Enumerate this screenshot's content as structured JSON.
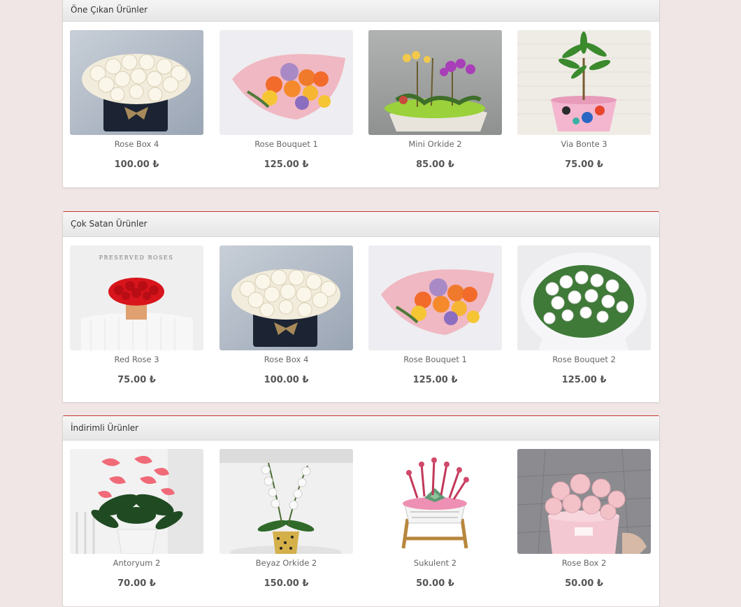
{
  "sections": [
    {
      "title": "Öne Çıkan Ürünler",
      "products": [
        {
          "name": "Rose Box 4",
          "price": "100.00 ₺",
          "image": "white-roses-box"
        },
        {
          "name": "Rose Bouquet 1",
          "price": "125.00 ₺",
          "image": "mixed-rose-bouquet"
        },
        {
          "name": "Mini Orkide 2",
          "price": "85.00 ₺",
          "image": "mini-orchid-arrangement"
        },
        {
          "name": "Via Bonte 3",
          "price": "75.00 ₺",
          "image": "plant-painted-pot"
        }
      ]
    },
    {
      "title": "Çok Satan Ürünler",
      "products": [
        {
          "name": "Red Rose 3",
          "price": "75.00 ₺",
          "image": "red-roses-preserved",
          "image_text": "PRESERVED ROSES"
        },
        {
          "name": "Rose Box 4",
          "price": "100.00 ₺",
          "image": "white-roses-box"
        },
        {
          "name": "Rose Bouquet 1",
          "price": "125.00 ₺",
          "image": "mixed-rose-bouquet"
        },
        {
          "name": "Rose Bouquet 2",
          "price": "125.00 ₺",
          "image": "white-rose-bouquet"
        }
      ]
    },
    {
      "title": "İndirimli Ürünler",
      "products": [
        {
          "name": "Antoryum 2",
          "price": "70.00 ₺",
          "image": "anthurium-plant"
        },
        {
          "name": "Beyaz Orkide 2",
          "price": "150.00 ₺",
          "image": "white-orchid"
        },
        {
          "name": "Sukulent 2",
          "price": "50.00 ₺",
          "image": "succulent-arrangement"
        },
        {
          "name": "Rose Box 2",
          "price": "50.00 ₺",
          "image": "pink-roses-box"
        }
      ]
    }
  ],
  "colors": {
    "page_background": "#f0e6e6",
    "panel_accent": "#c0392b"
  }
}
